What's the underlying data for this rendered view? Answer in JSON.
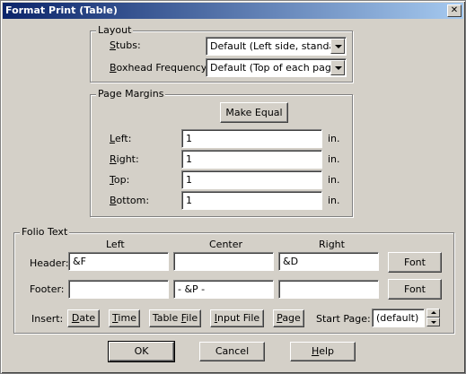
{
  "window": {
    "title": "Format Print (Table)",
    "close_glyph": "✕"
  },
  "layout": {
    "legend": "Layout",
    "stubs": {
      "label_underline": "S",
      "label_rest": "tubs:",
      "value": "Default (Left side, standard)"
    },
    "boxhead": {
      "label_underline": "B",
      "label_rest": "oxhead Frequency:",
      "value": "Default (Top of each page)"
    }
  },
  "margins": {
    "legend": "Page Margins",
    "make_equal_label": "Make Equal",
    "unit": "in.",
    "left": {
      "label_underline": "L",
      "label_rest": "eft:",
      "value": "1"
    },
    "right": {
      "label_underline": "R",
      "label_rest": "ight:",
      "value": "1"
    },
    "top": {
      "label_underline": "T",
      "label_rest": "op:",
      "value": "1"
    },
    "bottom": {
      "label_underline": "B",
      "label_rest": "ottom:",
      "value": "1"
    }
  },
  "folio": {
    "legend": "Folio Text",
    "col_left": "Left",
    "col_center": "Center",
    "col_right": "Right",
    "header_label": "Header:",
    "footer_label": "Footer:",
    "header_left": "&F",
    "header_center": "",
    "header_right": "&D",
    "footer_left": "",
    "footer_center": "- &P -",
    "footer_right": "",
    "font_label": "Font",
    "insert_label": "Insert:",
    "insert_date": {
      "u": "D",
      "rest": "ate"
    },
    "insert_time": {
      "u": "T",
      "rest": "ime"
    },
    "insert_tablefile": {
      "pre": "Table ",
      "u": "F",
      "rest": "ile"
    },
    "insert_inputfile": {
      "pre": "",
      "u": "I",
      "rest": "nput File"
    },
    "insert_page": {
      "u": "P",
      "rest": "age"
    },
    "start_page_label": "Start Page:",
    "start_page_value": "(default)"
  },
  "footer_buttons": {
    "ok": "OK",
    "cancel": "Cancel",
    "help_u": "H",
    "help_rest": "elp"
  }
}
